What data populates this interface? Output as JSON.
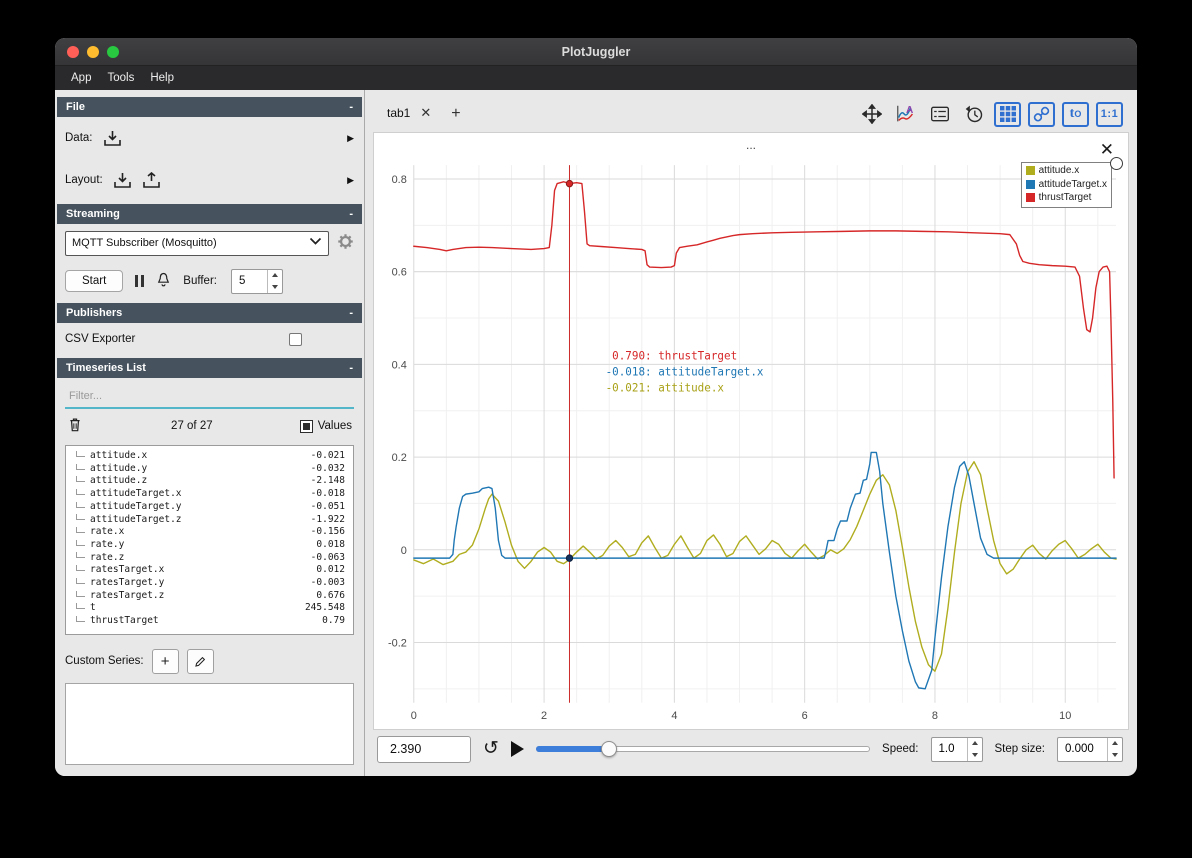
{
  "window": {
    "title": "PlotJuggler"
  },
  "menubar": {
    "items": [
      "App",
      "Tools",
      "Help"
    ]
  },
  "sidebar": {
    "file": {
      "title": "File",
      "collapse": "-",
      "data_label": "Data:",
      "layout_label": "Layout:"
    },
    "streaming": {
      "title": "Streaming",
      "collapse": "-",
      "source": "MQTT Subscriber (Mosquitto)",
      "start_label": "Start",
      "buffer_label": "Buffer:",
      "buffer_value": "5"
    },
    "publishers": {
      "title": "Publishers",
      "collapse": "-",
      "csv_label": "CSV Exporter"
    },
    "timeseries": {
      "title": "Timeseries List",
      "collapse": "-",
      "filter_placeholder": "Filter...",
      "count_label": "27 of 27",
      "values_label": "Values",
      "custom_series_label": "Custom Series:",
      "items": [
        {
          "name": "attitude.x",
          "value": "-0.021"
        },
        {
          "name": "attitude.y",
          "value": "-0.032"
        },
        {
          "name": "attitude.z",
          "value": "-2.148"
        },
        {
          "name": "attitudeTarget.x",
          "value": "-0.018"
        },
        {
          "name": "attitudeTarget.y",
          "value": "-0.051"
        },
        {
          "name": "attitudeTarget.z",
          "value": "-1.922"
        },
        {
          "name": "rate.x",
          "value": "-0.156"
        },
        {
          "name": "rate.y",
          "value": "0.018"
        },
        {
          "name": "rate.z",
          "value": "-0.063"
        },
        {
          "name": "ratesTarget.x",
          "value": "0.012"
        },
        {
          "name": "ratesTarget.y",
          "value": "-0.003"
        },
        {
          "name": "ratesTarget.z",
          "value": "0.676"
        },
        {
          "name": "t",
          "value": "245.548"
        },
        {
          "name": "thrustTarget",
          "value": "0.79"
        }
      ]
    }
  },
  "main": {
    "tab_label": "tab1",
    "plot_title": "...",
    "toolbar": {
      "buttons": [
        "pan-zoom",
        "curve-editor",
        "legend-toggle",
        "time-tracker",
        "grid-view",
        "link-axes",
        "time-offset",
        "aspect-ratio"
      ],
      "t0_main": "t",
      "t0_sub": "O",
      "ratio_label": "1:1",
      "accent_color": "#2f6fd0"
    },
    "legend": [
      {
        "label": "attitude.x",
        "color": "#b0ad1f"
      },
      {
        "label": "attitudeTarget.x",
        "color": "#1f77b4"
      },
      {
        "label": "thrustTarget",
        "color": "#d62728"
      }
    ]
  },
  "playback": {
    "time": "2.390",
    "speed_label": "Speed:",
    "speed_value": "1.0",
    "step_label": "Step size:",
    "step_value": "0.000"
  },
  "chart_data": {
    "type": "line",
    "title": "...",
    "xlim": [
      0,
      10.78
    ],
    "ylim": [
      -0.33,
      0.83
    ],
    "x_ticks": [
      0,
      2,
      4,
      6,
      8,
      10
    ],
    "y_ticks": [
      -0.2,
      0,
      0.2,
      0.4,
      0.6,
      0.8
    ],
    "grid": true,
    "legend_position": "top-right",
    "cursor": {
      "x": 2.39,
      "dots": [
        {
          "y": 0.79,
          "fill": "#d62728",
          "stroke": "#8b1a1a"
        },
        {
          "y": -0.018,
          "fill": "#16325c",
          "stroke": "#0d1f3c"
        }
      ],
      "tooltip": [
        {
          "value": "0.790",
          "series": "thrustTarget",
          "color": "#d62728"
        },
        {
          "value": "-0.018",
          "series": "attitudeTarget.x",
          "color": "#1f77b4"
        },
        {
          "value": "-0.021",
          "series": "attitude.x",
          "color": "#a8a117"
        }
      ]
    },
    "series": [
      {
        "name": "attitude.x",
        "color": "#b0ad1f",
        "points": [
          [
            0,
            -0.022
          ],
          [
            0.15,
            -0.03
          ],
          [
            0.3,
            -0.02
          ],
          [
            0.45,
            -0.032
          ],
          [
            0.6,
            -0.025
          ],
          [
            0.7,
            -0.01
          ],
          [
            0.8,
            -0.005
          ],
          [
            0.9,
            0.01
          ],
          [
            1.0,
            0.045
          ],
          [
            1.1,
            0.09
          ],
          [
            1.15,
            0.11
          ],
          [
            1.2,
            0.12
          ],
          [
            1.3,
            0.105
          ],
          [
            1.4,
            0.06
          ],
          [
            1.5,
            0.01
          ],
          [
            1.6,
            -0.025
          ],
          [
            1.7,
            -0.04
          ],
          [
            1.8,
            -0.025
          ],
          [
            1.9,
            -0.005
          ],
          [
            2.0,
            0.005
          ],
          [
            2.1,
            -0.005
          ],
          [
            2.2,
            -0.025
          ],
          [
            2.3,
            -0.03
          ],
          [
            2.39,
            -0.021
          ],
          [
            2.5,
            -0.005
          ],
          [
            2.6,
            0.008
          ],
          [
            2.7,
            -0.005
          ],
          [
            2.8,
            -0.02
          ],
          [
            2.9,
            -0.012
          ],
          [
            3.0,
            0.008
          ],
          [
            3.1,
            0.02
          ],
          [
            3.2,
            0.005
          ],
          [
            3.3,
            -0.015
          ],
          [
            3.4,
            -0.01
          ],
          [
            3.5,
            0.015
          ],
          [
            3.6,
            0.03
          ],
          [
            3.7,
            0.005
          ],
          [
            3.8,
            -0.018
          ],
          [
            3.9,
            -0.012
          ],
          [
            4.0,
            0.012
          ],
          [
            4.1,
            0.03
          ],
          [
            4.2,
            0.005
          ],
          [
            4.3,
            -0.018
          ],
          [
            4.4,
            -0.008
          ],
          [
            4.5,
            0.02
          ],
          [
            4.6,
            0.032
          ],
          [
            4.7,
            0.012
          ],
          [
            4.8,
            -0.015
          ],
          [
            4.9,
            -0.008
          ],
          [
            5.0,
            0.018
          ],
          [
            5.1,
            0.03
          ],
          [
            5.2,
            0.01
          ],
          [
            5.3,
            -0.01
          ],
          [
            5.4,
            0.002
          ],
          [
            5.5,
            0.02
          ],
          [
            5.6,
            0.012
          ],
          [
            5.7,
            -0.008
          ],
          [
            5.8,
            -0.018
          ],
          [
            5.9,
            -0.002
          ],
          [
            6.0,
            0.012
          ],
          [
            6.1,
            -0.005
          ],
          [
            6.2,
            -0.02
          ],
          [
            6.3,
            -0.012
          ],
          [
            6.4,
            0.0
          ],
          [
            6.5,
            -0.008
          ],
          [
            6.6,
            0.002
          ],
          [
            6.7,
            0.022
          ],
          [
            6.8,
            0.05
          ],
          [
            6.9,
            0.085
          ],
          [
            7.0,
            0.12
          ],
          [
            7.1,
            0.15
          ],
          [
            7.2,
            0.162
          ],
          [
            7.3,
            0.14
          ],
          [
            7.4,
            0.085
          ],
          [
            7.5,
            0.005
          ],
          [
            7.6,
            -0.08
          ],
          [
            7.7,
            -0.155
          ],
          [
            7.8,
            -0.21
          ],
          [
            7.9,
            -0.248
          ],
          [
            8.0,
            -0.262
          ],
          [
            8.1,
            -0.225
          ],
          [
            8.2,
            -0.125
          ],
          [
            8.3,
            -0.005
          ],
          [
            8.4,
            0.1
          ],
          [
            8.5,
            0.168
          ],
          [
            8.6,
            0.19
          ],
          [
            8.7,
            0.162
          ],
          [
            8.8,
            0.09
          ],
          [
            8.9,
            0.02
          ],
          [
            9.0,
            -0.03
          ],
          [
            9.1,
            -0.052
          ],
          [
            9.2,
            -0.042
          ],
          [
            9.3,
            -0.02
          ],
          [
            9.4,
            0.0
          ],
          [
            9.5,
            0.01
          ],
          [
            9.6,
            -0.008
          ],
          [
            9.7,
            -0.02
          ],
          [
            9.8,
            -0.002
          ],
          [
            9.9,
            0.012
          ],
          [
            10.0,
            0.02
          ],
          [
            10.1,
            0.002
          ],
          [
            10.2,
            -0.018
          ],
          [
            10.3,
            -0.01
          ],
          [
            10.4,
            0.002
          ],
          [
            10.5,
            0.012
          ],
          [
            10.6,
            -0.005
          ],
          [
            10.7,
            -0.018
          ],
          [
            10.78,
            -0.02
          ]
        ]
      },
      {
        "name": "attitudeTarget.x",
        "color": "#1f77b4",
        "points": [
          [
            0,
            -0.018
          ],
          [
            0.55,
            -0.018
          ],
          [
            0.6,
            -0.01
          ],
          [
            0.62,
            0.02
          ],
          [
            0.65,
            0.05
          ],
          [
            0.7,
            0.09
          ],
          [
            0.75,
            0.115
          ],
          [
            0.8,
            0.12
          ],
          [
            0.9,
            0.122
          ],
          [
            1.0,
            0.125
          ],
          [
            1.05,
            0.132
          ],
          [
            1.15,
            0.135
          ],
          [
            1.2,
            0.132
          ],
          [
            1.25,
            0.09
          ],
          [
            1.3,
            0.02
          ],
          [
            1.35,
            -0.012
          ],
          [
            1.4,
            -0.018
          ],
          [
            2.0,
            -0.018
          ],
          [
            3.0,
            -0.018
          ],
          [
            4.0,
            -0.018
          ],
          [
            5.0,
            -0.018
          ],
          [
            6.0,
            -0.018
          ],
          [
            6.3,
            -0.018
          ],
          [
            6.33,
            0.0
          ],
          [
            6.36,
            0.02
          ],
          [
            6.45,
            0.02
          ],
          [
            6.5,
            0.045
          ],
          [
            6.55,
            0.062
          ],
          [
            6.65,
            0.062
          ],
          [
            6.7,
            0.09
          ],
          [
            6.78,
            0.12
          ],
          [
            6.85,
            0.122
          ],
          [
            6.9,
            0.15
          ],
          [
            6.95,
            0.152
          ],
          [
            7.0,
            0.185
          ],
          [
            7.02,
            0.21
          ],
          [
            7.1,
            0.21
          ],
          [
            7.15,
            0.17
          ],
          [
            7.2,
            0.1
          ],
          [
            7.3,
            -0.005
          ],
          [
            7.4,
            -0.1
          ],
          [
            7.5,
            -0.175
          ],
          [
            7.6,
            -0.24
          ],
          [
            7.7,
            -0.285
          ],
          [
            7.75,
            -0.298
          ],
          [
            7.85,
            -0.3
          ],
          [
            7.95,
            -0.26
          ],
          [
            8.0,
            -0.19
          ],
          [
            8.1,
            -0.06
          ],
          [
            8.2,
            0.05
          ],
          [
            8.3,
            0.135
          ],
          [
            8.38,
            0.18
          ],
          [
            8.45,
            0.19
          ],
          [
            8.52,
            0.16
          ],
          [
            8.6,
            0.1
          ],
          [
            8.7,
            0.025
          ],
          [
            8.8,
            -0.01
          ],
          [
            8.9,
            -0.018
          ],
          [
            10.78,
            -0.018
          ]
        ]
      },
      {
        "name": "thrustTarget",
        "color": "#d62728",
        "points": [
          [
            0,
            0.655
          ],
          [
            0.2,
            0.652
          ],
          [
            0.4,
            0.648
          ],
          [
            0.5,
            0.645
          ],
          [
            0.6,
            0.648
          ],
          [
            0.8,
            0.652
          ],
          [
            1.0,
            0.653
          ],
          [
            1.2,
            0.652
          ],
          [
            1.5,
            0.65
          ],
          [
            1.8,
            0.648
          ],
          [
            2.0,
            0.65
          ],
          [
            2.08,
            0.652
          ],
          [
            2.12,
            0.7
          ],
          [
            2.16,
            0.775
          ],
          [
            2.2,
            0.79
          ],
          [
            2.3,
            0.794
          ],
          [
            2.39,
            0.79
          ],
          [
            2.5,
            0.792
          ],
          [
            2.58,
            0.79
          ],
          [
            2.62,
            0.73
          ],
          [
            2.66,
            0.66
          ],
          [
            2.7,
            0.656
          ],
          [
            2.9,
            0.654
          ],
          [
            3.1,
            0.652
          ],
          [
            3.3,
            0.65
          ],
          [
            3.5,
            0.648
          ],
          [
            3.55,
            0.645
          ],
          [
            3.58,
            0.615
          ],
          [
            3.62,
            0.61
          ],
          [
            3.8,
            0.609
          ],
          [
            3.95,
            0.61
          ],
          [
            4.0,
            0.613
          ],
          [
            4.03,
            0.64
          ],
          [
            4.08,
            0.652
          ],
          [
            4.2,
            0.655
          ],
          [
            4.35,
            0.658
          ],
          [
            4.5,
            0.664
          ],
          [
            4.6,
            0.668
          ],
          [
            4.7,
            0.672
          ],
          [
            4.8,
            0.675
          ],
          [
            4.9,
            0.678
          ],
          [
            5.0,
            0.68
          ],
          [
            5.2,
            0.682
          ],
          [
            5.5,
            0.684
          ],
          [
            5.8,
            0.685
          ],
          [
            6.2,
            0.686
          ],
          [
            6.6,
            0.687
          ],
          [
            7.0,
            0.688
          ],
          [
            7.4,
            0.688
          ],
          [
            7.8,
            0.687
          ],
          [
            8.2,
            0.686
          ],
          [
            8.6,
            0.684
          ],
          [
            9.0,
            0.682
          ],
          [
            9.15,
            0.68
          ],
          [
            9.25,
            0.66
          ],
          [
            9.3,
            0.635
          ],
          [
            9.35,
            0.622
          ],
          [
            9.45,
            0.618
          ],
          [
            9.6,
            0.615
          ],
          [
            9.8,
            0.613
          ],
          [
            10.0,
            0.612
          ],
          [
            10.15,
            0.61
          ],
          [
            10.22,
            0.59
          ],
          [
            10.28,
            0.52
          ],
          [
            10.33,
            0.475
          ],
          [
            10.38,
            0.47
          ],
          [
            10.42,
            0.5
          ],
          [
            10.47,
            0.565
          ],
          [
            10.52,
            0.6
          ],
          [
            10.58,
            0.61
          ],
          [
            10.64,
            0.612
          ],
          [
            10.68,
            0.6
          ],
          [
            10.7,
            0.5
          ],
          [
            10.73,
            0.32
          ],
          [
            10.75,
            0.155
          ]
        ]
      }
    ]
  }
}
